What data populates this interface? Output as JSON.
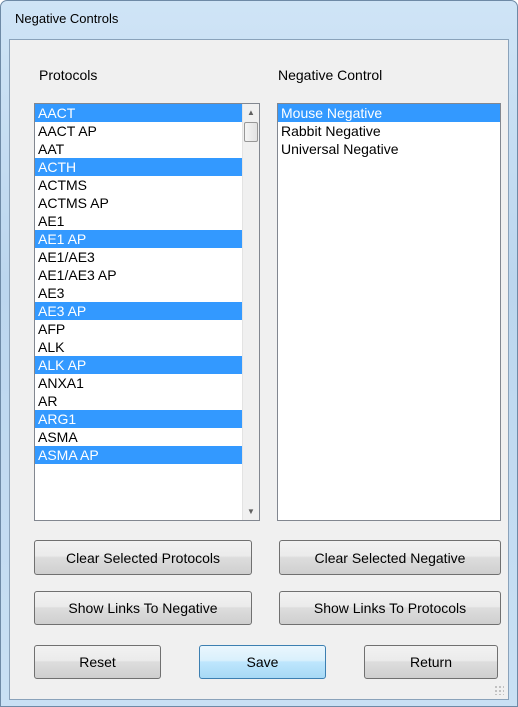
{
  "window": {
    "title": "Negative Controls"
  },
  "protocols": {
    "label": "Protocols",
    "items": [
      {
        "text": "AACT",
        "selected": true
      },
      {
        "text": "AACT AP",
        "selected": false
      },
      {
        "text": "AAT",
        "selected": false
      },
      {
        "text": "ACTH",
        "selected": true
      },
      {
        "text": "ACTMS",
        "selected": false
      },
      {
        "text": "ACTMS AP",
        "selected": false
      },
      {
        "text": "AE1",
        "selected": false
      },
      {
        "text": "AE1 AP",
        "selected": true
      },
      {
        "text": "AE1/AE3",
        "selected": false
      },
      {
        "text": "AE1/AE3 AP",
        "selected": false
      },
      {
        "text": "AE3",
        "selected": false
      },
      {
        "text": "AE3 AP",
        "selected": true
      },
      {
        "text": "AFP",
        "selected": false
      },
      {
        "text": "ALK",
        "selected": false
      },
      {
        "text": "ALK AP",
        "selected": true
      },
      {
        "text": "ANXA1",
        "selected": false
      },
      {
        "text": "AR",
        "selected": false
      },
      {
        "text": "ARG1",
        "selected": true
      },
      {
        "text": "ASMA",
        "selected": false
      },
      {
        "text": "ASMA AP",
        "selected": true
      }
    ]
  },
  "negative": {
    "label": "Negative Control",
    "items": [
      {
        "text": "Mouse Negative",
        "selected": true
      },
      {
        "text": "Rabbit Negative",
        "selected": false
      },
      {
        "text": "Universal Negative",
        "selected": false
      }
    ]
  },
  "buttons": {
    "clear_protocols": "Clear Selected Protocols",
    "clear_negative": "Clear Selected Negative",
    "links_to_negative": "Show Links To Negative",
    "links_to_protocols": "Show Links To Protocols",
    "reset": "Reset",
    "save": "Save",
    "return": "Return"
  },
  "icons": {
    "scroll_up": "scroll-up-arrow-icon",
    "scroll_down": "scroll-down-arrow-icon",
    "resize_grip": "resize-grip-icon"
  },
  "colors": {
    "selection": "#3399ff",
    "frame": "#bcd6ee",
    "client": "#f0f0f0"
  }
}
